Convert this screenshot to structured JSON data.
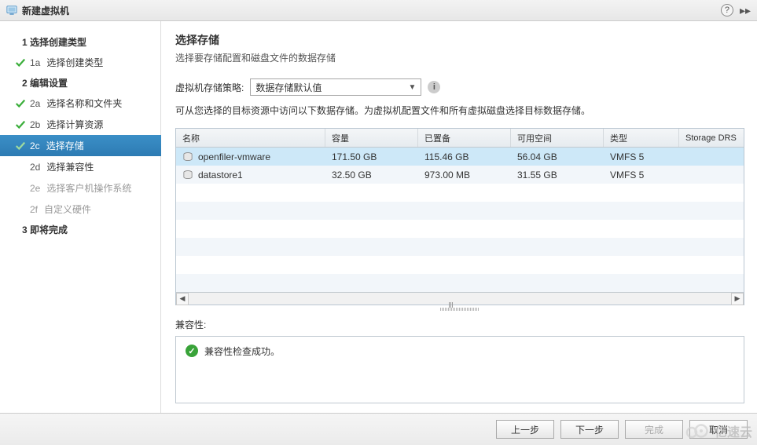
{
  "titlebar": {
    "title": "新建虚拟机"
  },
  "sidebar": {
    "group1": {
      "num": "1",
      "label": "选择创建类型"
    },
    "items1": [
      {
        "num": "1a",
        "label": "选择创建类型",
        "done": true
      }
    ],
    "group2": {
      "num": "2",
      "label": "编辑设置"
    },
    "items2": [
      {
        "num": "2a",
        "label": "选择名称和文件夹",
        "done": true
      },
      {
        "num": "2b",
        "label": "选择计算资源",
        "done": true
      },
      {
        "num": "2c",
        "label": "选择存储",
        "active": true
      },
      {
        "num": "2d",
        "label": "选择兼容性"
      },
      {
        "num": "2e",
        "label": "选择客户机操作系统",
        "disabled": true
      },
      {
        "num": "2f",
        "label": "自定义硬件",
        "disabled": true
      }
    ],
    "group3": {
      "num": "3",
      "label": "即将完成"
    }
  },
  "content": {
    "title": "选择存储",
    "subtitle": "选择要存储配置和磁盘文件的数据存储",
    "policy_label": "虚拟机存储策略:",
    "policy_value": "数据存储默认值",
    "instructions": "可从您选择的目标资源中访问以下数据存储。为虚拟机配置文件和所有虚拟磁盘选择目标数据存储。",
    "columns": {
      "name": "名称",
      "capacity": "容量",
      "provisioned": "已置备",
      "free": "可用空间",
      "type": "类型",
      "drs": "Storage DRS"
    },
    "rows": [
      {
        "name": "openfiler-vmware",
        "capacity": "171.50 GB",
        "provisioned": "115.46 GB",
        "free": "56.04 GB",
        "type": "VMFS 5",
        "drs": "",
        "selected": true
      },
      {
        "name": "datastore1",
        "capacity": "32.50 GB",
        "provisioned": "973.00 MB",
        "free": "31.55 GB",
        "type": "VMFS 5",
        "drs": ""
      }
    ],
    "compat_label": "兼容性:",
    "compat_msg": "兼容性检查成功。"
  },
  "footer": {
    "back": "上一步",
    "next": "下一步",
    "finish": "完成",
    "cancel": "取消"
  },
  "watermark": "亿速云"
}
